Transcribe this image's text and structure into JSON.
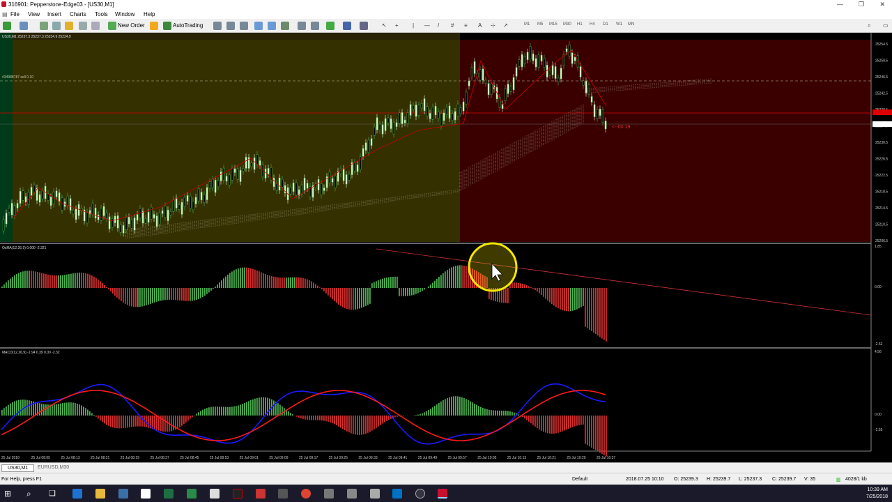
{
  "window": {
    "title": "316901: Pepperstone-Edge03 - [US30,M1]"
  },
  "menu": [
    "File",
    "View",
    "Insert",
    "Charts",
    "Tools",
    "Window",
    "Help"
  ],
  "toolbar": {
    "new_order": "New Order",
    "autotrading": "AutoTrading",
    "timeframes": [
      "M1",
      "M5",
      "M15",
      "M30",
      "H1",
      "H4",
      "D1",
      "W1",
      "MN"
    ]
  },
  "main_chart": {
    "label": "US30,M1  25237.3 25237.3 25234.9 25234.9",
    "order_line": "#34988787 sell 0.10",
    "countdown": "<--00:19",
    "price_ticks": [
      "25254.5",
      "25250.5",
      "25246.5",
      "25242.5",
      "25238.5",
      "25234.9",
      "25230.5",
      "25226.5",
      "25222.5",
      "25218.5",
      "25214.5",
      "25210.5",
      "25206.5"
    ]
  },
  "osma": {
    "label": "OsMA(12,26,9) 0.000 -2.321",
    "ticks": [
      "1.85",
      "0.00",
      "-2.52"
    ]
  },
  "macd": {
    "label": "MACD(12,26,9) -1.94 0.39 0.00 -2.32",
    "ticks": [
      "4.56",
      "0.00",
      "-2.65"
    ]
  },
  "time_axis": [
    "25 Jul 2018",
    "25 Jul 08:05",
    "25 Jul 08:13",
    "25 Jul 08:21",
    "25 Jul 08:29",
    "25 Jul 08:37",
    "25 Jul 08:45",
    "25 Jul 08:53",
    "25 Jul 09:01",
    "25 Jul 09:09",
    "25 Jul 09:17",
    "25 Jul 09:25",
    "25 Jul 09:33",
    "25 Jul 09:41",
    "25 Jul 09:49",
    "25 Jul 09:57",
    "25 Jul 10:05",
    "25 Jul 10:13",
    "25 Jul 10:21",
    "25 Jul 10:29",
    "25 Jul 10:37"
  ],
  "tabs": [
    "US30,M1",
    "EURUSD,M30"
  ],
  "status": {
    "help": "For Help, press F1",
    "profile": "Default",
    "time": "2018.07.25 10:10",
    "open": "O: 25239.3",
    "high": "H: 25239.7",
    "low": "L: 25237.3",
    "close": "C: 25239.7",
    "volume": "V: 35",
    "traffic": "4028/1 kb"
  },
  "clock": {
    "time": "10:39 AM",
    "date": "7/25/2018"
  },
  "colors": {
    "bull": "#4caf50",
    "bear": "#d32f2f",
    "signal": "#ff0000",
    "macd_line": "#1a1aff",
    "highlight": "#f7e600"
  }
}
